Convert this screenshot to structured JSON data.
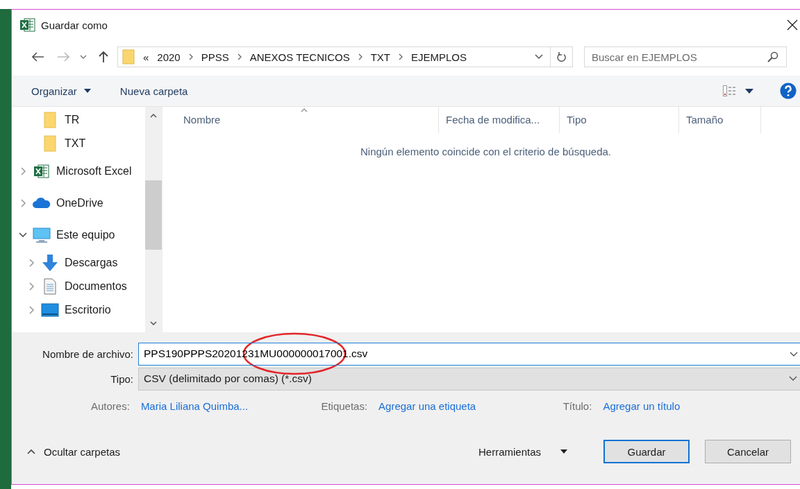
{
  "window": {
    "title": "Guardar como"
  },
  "nav": {
    "overflow": "«",
    "path": [
      "2020",
      "PPSS",
      "ANEXOS TECNICOS",
      "TXT",
      "EJEMPLOS"
    ],
    "search_placeholder": "Buscar en EJEMPLOS"
  },
  "toolbar": {
    "organize": "Organizar",
    "new_folder": "Nueva carpeta"
  },
  "sidebar": {
    "items": [
      {
        "label": "TR",
        "kind": "folder"
      },
      {
        "label": "TXT",
        "kind": "folder"
      },
      {
        "label": "Microsoft Excel",
        "kind": "excel",
        "expanded": false
      },
      {
        "label": "OneDrive",
        "kind": "cloud",
        "expanded": false
      },
      {
        "label": "Este equipo",
        "kind": "computer",
        "expanded": true,
        "children": [
          {
            "label": "Descargas",
            "kind": "download",
            "expanded": false
          },
          {
            "label": "Documentos",
            "kind": "document",
            "expanded": false
          },
          {
            "label": "Escritorio",
            "kind": "desktop",
            "expanded": false
          }
        ]
      }
    ]
  },
  "table": {
    "columns": [
      {
        "label": "Nombre",
        "sorted": true
      },
      {
        "label": "Fecha de modifica...",
        "sorted": false
      },
      {
        "label": "Tipo",
        "sorted": false
      },
      {
        "label": "Tamaño",
        "sorted": false
      }
    ],
    "empty_message": "Ningún elemento coincide con el criterio de búsqueda."
  },
  "form": {
    "file_name_label": "Nombre de archivo:",
    "file_name": "PPS190PPPS20201231MU000000017001.csv",
    "type_label": "Tipo:",
    "type": "CSV (delimitado por comas) (*.csv)",
    "meta": [
      {
        "label": "Autores:",
        "value": "Maria Liliana Quimba..."
      },
      {
        "label": "Etiquetas:",
        "value": "Agregar una etiqueta"
      },
      {
        "label": "Título:",
        "value": "Agregar un título"
      }
    ]
  },
  "footer": {
    "hide_folders": "Ocultar carpetas",
    "tools": "Herramientas",
    "buttons": [
      {
        "label": "Guardar",
        "default": true
      },
      {
        "label": "Cancelar",
        "default": false
      }
    ]
  },
  "annotations": [
    {
      "kind": "ellipse"
    }
  ]
}
